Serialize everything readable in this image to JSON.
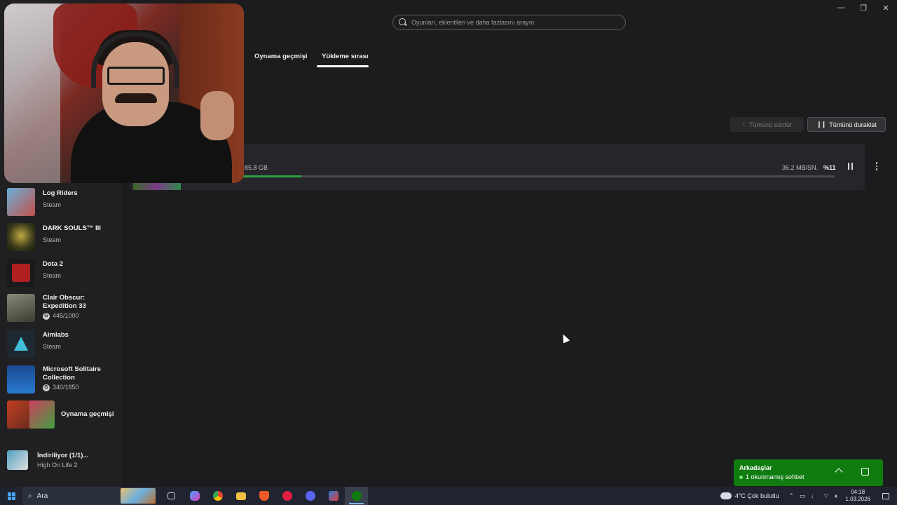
{
  "window": {
    "minimize": "—",
    "restore": "❐",
    "close": "✕"
  },
  "search": {
    "placeholder": "Oyunları, eklentileri ve daha fazlasını arayın"
  },
  "tabs": [
    {
      "label": "Oynama geçmişi",
      "active": false
    },
    {
      "label": "Yükleme sırası",
      "active": true
    }
  ],
  "actions": {
    "resume_all": "Tümünü sürdür",
    "pause_all": "Tümünü duraklat"
  },
  "download": {
    "size": "/ 85.8 GB",
    "speed": "36.2 MB/SN.",
    "percent": "%11",
    "progress": 0.11
  },
  "sidebar": {
    "items": [
      {
        "title": "Log Riders",
        "sub": "Steam",
        "icon": "log-riders-icon",
        "color": "#c0504a"
      },
      {
        "title": "DARK SOULS™ III",
        "sub": "Steam",
        "icon": "dark-souls-icon",
        "color": "#5a5a2a"
      },
      {
        "title": "Dota 2",
        "sub": "Steam",
        "icon": "dota2-icon",
        "color": "#8a1a1a"
      },
      {
        "title": "Clair Obscur: Expedition 33",
        "sub": "445/1000",
        "achievements": true,
        "icon": "clair-obscur-icon",
        "color": "#6a6a5a"
      },
      {
        "title": "Aimlabs",
        "sub": "Steam",
        "icon": "aimlabs-icon",
        "color": "#1a3a4a"
      },
      {
        "title": "Microsoft Solitaire Collection",
        "sub": "340/1850",
        "achievements": true,
        "icon": "solitaire-icon",
        "color": "#1a5aa0"
      }
    ],
    "history_label": "Oynama geçmişi",
    "downloading": {
      "title": "İndiriliyor (1/1)...",
      "sub": "High On Life 2"
    }
  },
  "friends": {
    "title": "Arkadaşlar",
    "status": "1 okunmamış sohbet"
  },
  "taskbar": {
    "search_label": "Ara",
    "weather": "4°C  Çok bulutlu",
    "time": "04:18",
    "date": "1.03.2026"
  }
}
